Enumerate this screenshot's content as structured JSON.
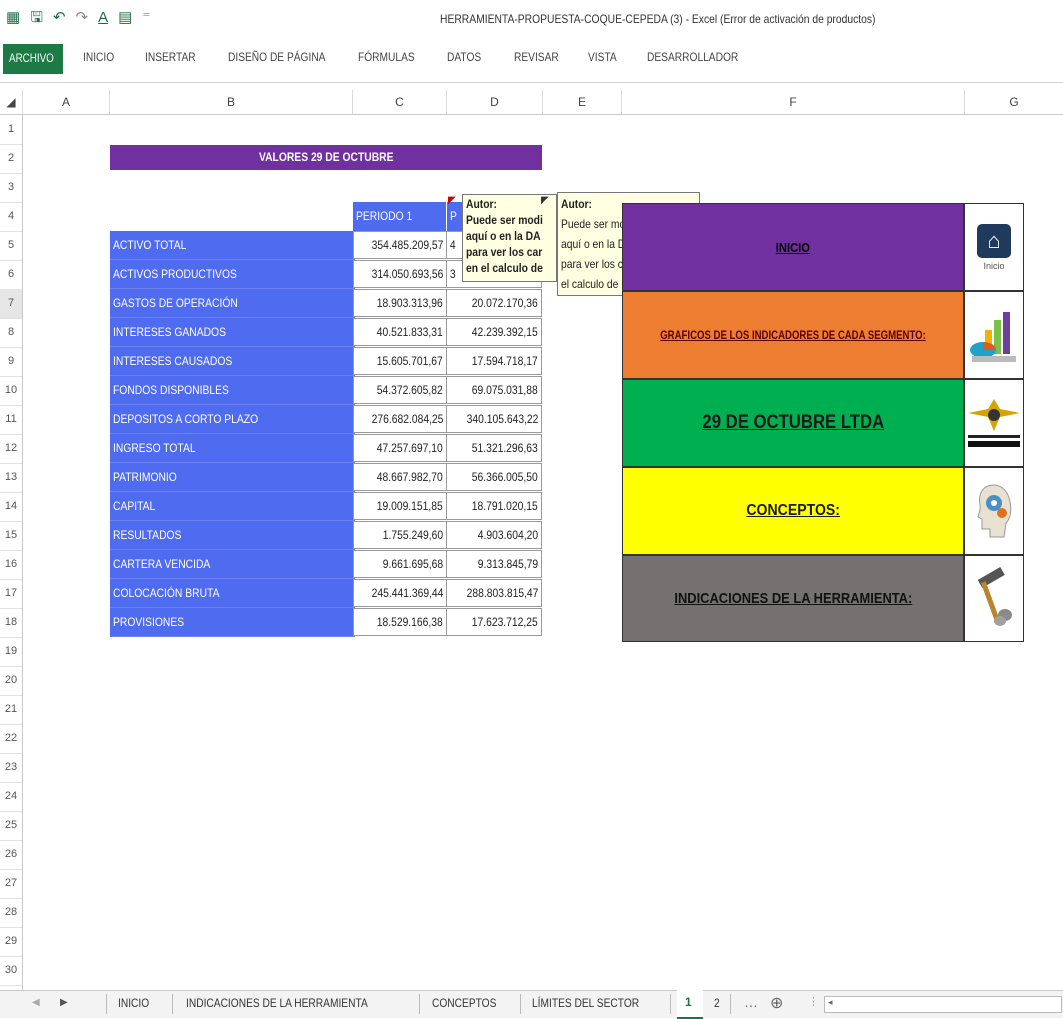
{
  "window": {
    "title": "HERRAMIENTA-PROPUESTA-COQUE-CEPEDA (3) - Excel (Error de activación de productos)"
  },
  "ribbon": {
    "tabs": [
      "ARCHIVO",
      "INICIO",
      "INSERTAR",
      "DISEÑO DE PÁGINA",
      "FÓRMULAS",
      "DATOS",
      "REVISAR",
      "VISTA",
      "DESARROLLADOR"
    ]
  },
  "columns": [
    "A",
    "B",
    "C",
    "D",
    "E",
    "F",
    "G"
  ],
  "rows": [
    "1",
    "2",
    "3",
    "4",
    "5",
    "6",
    "7",
    "8",
    "9",
    "10",
    "11",
    "12",
    "13",
    "14",
    "15",
    "16",
    "17",
    "18",
    "19",
    "20",
    "21",
    "22",
    "23",
    "24",
    "25",
    "26",
    "27",
    "28",
    "29",
    "30"
  ],
  "sheet": {
    "title": "VALORES 29 DE OCTUBRE",
    "period1_header": "PERIODO 1",
    "period2_header_visible": "P",
    "table": [
      {
        "label": "ACTIVO TOTAL",
        "p1": "354.485.209,57",
        "p2": "4"
      },
      {
        "label": "ACTIVOS PRODUCTIVOS",
        "p1": "314.050.693,56",
        "p2": "3"
      },
      {
        "label": "GASTOS DE OPERACIÓN",
        "p1": "18.903.313,96",
        "p2": "20.072.170,36"
      },
      {
        "label": "INTERESES GANADOS",
        "p1": "40.521.833,31",
        "p2": "42.239.392,15"
      },
      {
        "label": "INTERESES CAUSADOS",
        "p1": "15.605.701,67",
        "p2": "17.594.718,17"
      },
      {
        "label": "FONDOS DISPONIBLES",
        "p1": "54.372.605,82",
        "p2": "69.075.031,88"
      },
      {
        "label": "DEPOSITOS A CORTO PLAZO",
        "p1": "276.682.084,25",
        "p2": "340.105.643,22"
      },
      {
        "label": "INGRESO TOTAL",
        "p1": "47.257.697,10",
        "p2": "51.321.296,63"
      },
      {
        "label": "PATRIMONIO",
        "p1": "48.667.982,70",
        "p2": "56.366.005,50"
      },
      {
        "label": "CAPITAL",
        "p1": "19.009.151,85",
        "p2": "18.791.020,15"
      },
      {
        "label": "RESULTADOS",
        "p1": "1.755.249,60",
        "p2": "4.903.604,20"
      },
      {
        "label": "CARTERA VENCIDA",
        "p1": "9.661.695,68",
        "p2": "9.313.845,79"
      },
      {
        "label": "COLOCACIÓN BRUTA",
        "p1": "245.441.369,44",
        "p2": "288.803.815,47"
      },
      {
        "label": "PROVISIONES",
        "p1": "18.529.166,38",
        "p2": "17.623.712,25"
      }
    ]
  },
  "comments": {
    "c1": {
      "author": "Autor:",
      "lines": [
        "Puede ser modi",
        "aquí o en la DA",
        "para ver los car",
        "en el calculo de"
      ]
    },
    "c2": {
      "author": "Autor:",
      "lines": [
        "Puede ser modificado",
        "aquí o en la DATOS P2",
        "para ver los cambios en",
        "el calculo de indicadores."
      ]
    }
  },
  "nav": [
    {
      "label": "INICIO",
      "color": "#7030a0",
      "icon": "home-icon",
      "icon_caption": "Inicio"
    },
    {
      "label": "GRAFICOS DE LOS INDICADORES DE CADA SEGMENTO:",
      "color": "#ed7d31",
      "icon": "chart-3d-icon"
    },
    {
      "label": "29 DE OCTUBRE LTDA",
      "color": "#00b050",
      "icon": "cooperative-logo-icon"
    },
    {
      "label": "CONCEPTOS:",
      "color": "#ffff00",
      "icon": "head-gears-icon"
    },
    {
      "label": "INDICACIONES DE LA HERRAMIENTA:",
      "color": "#767171",
      "icon": "hammer-icon"
    }
  ],
  "sheet_tabs": [
    "INICIO",
    "INDICACIONES DE LA HERRAMIENTA",
    "CONCEPTOS",
    "LÍMITES DEL SECTOR",
    "1",
    "2"
  ],
  "active_sheet_tab": "1"
}
